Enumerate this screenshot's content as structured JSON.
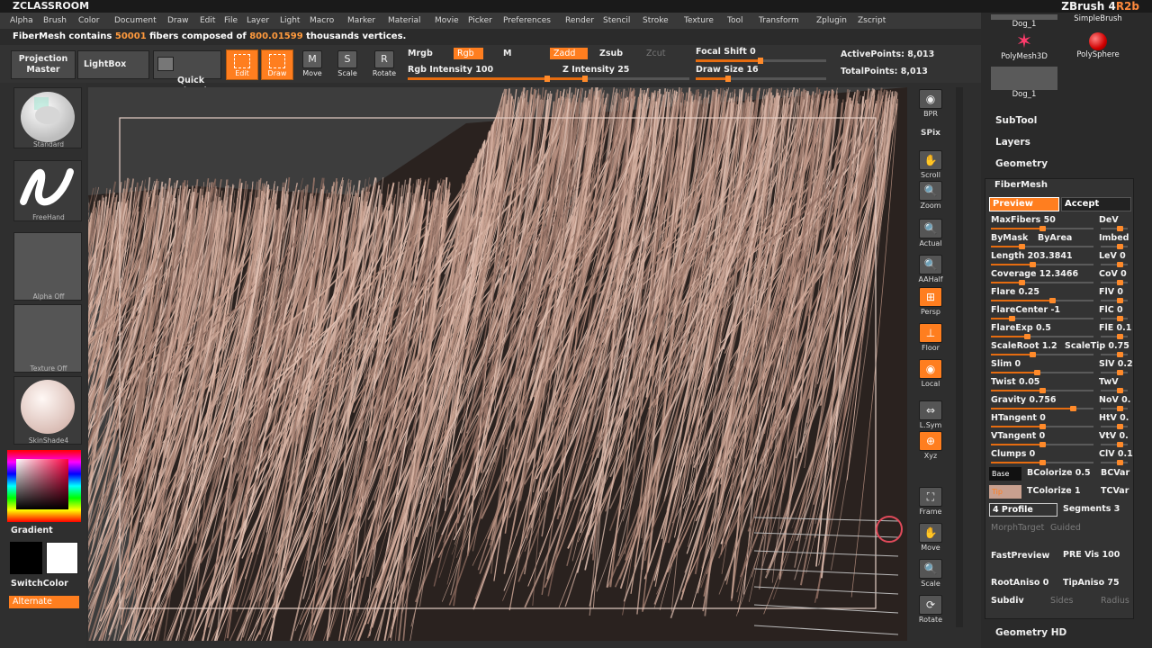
{
  "title_bar": {
    "brand": "ZCLASSROOM",
    "product": "ZBrush 4",
    "version": "R2b"
  },
  "menu": [
    "Alpha",
    "Brush",
    "Color",
    "Document",
    "Draw",
    "Edit",
    "File",
    "Layer",
    "Light",
    "Macro",
    "Marker",
    "Material",
    "Movie",
    "Picker",
    "Preferences",
    "Render",
    "Stencil",
    "Stroke",
    "Texture",
    "Tool",
    "Transform",
    "Zplugin",
    "Zscript"
  ],
  "notice": {
    "pre": "FiberMesh contains",
    "fibers": "50001",
    "mid": "fibers composed of",
    "verts": "800.01599",
    "post": "thousands vertices."
  },
  "toolbar": {
    "projection_master": "Projection\nMaster",
    "lightbox": "LightBox",
    "quick_sketch": "Quick\nSketch",
    "edit": "Edit",
    "draw": "Draw",
    "move": "Move",
    "scale": "Scale",
    "rotate": "Rotate",
    "mrgb": "Mrgb",
    "rgb": "Rgb",
    "m": "M",
    "zadd": "Zadd",
    "zsub": "Zsub",
    "zcut": "Zcut",
    "rgb_intensity": "Rgb  Intensity 100",
    "rgb_intensity_value": 100,
    "z_intensity": "Z  Intensity 25",
    "z_intensity_value": 25,
    "focal_shift": "Focal  Shift 0",
    "draw_size": "Draw  Size 16",
    "draw_size_value": 16,
    "active_points": "ActivePoints: 8,013",
    "total_points": "TotalPoints: 8,013"
  },
  "left_shelf": {
    "brush": "Standard",
    "stroke": "FreeHand",
    "alpha": "Alpha  Off",
    "texture": "Texture  Off",
    "material": "SkinShade4",
    "gradient": "Gradient",
    "switch_color": "SwitchColor",
    "alternate": "Alternate",
    "main_color": "#ffffff",
    "secondary_color": "#000000"
  },
  "right_shelf": [
    "BPR",
    "SPix",
    "Scroll",
    "Zoom",
    "Actual",
    "AAHalf",
    "Persp",
    "Floor",
    "Local",
    "L.Sym",
    "Xyz",
    "Frame",
    "Move",
    "Scale",
    "Rotate"
  ],
  "tool_tray": {
    "thumbs": [
      {
        "label": "Dog_1",
        "icon": "dog-mesh-icon"
      },
      {
        "label": "SimpleBrush",
        "icon": "simplebrush-icon"
      },
      {
        "label": "PolyMesh3D",
        "icon": "star-icon"
      },
      {
        "label": "PolySphere",
        "icon": "sphere-icon"
      },
      {
        "label": "Dog_1",
        "icon": "dog-mesh-icon"
      }
    ],
    "subtool": "SubTool",
    "layers": "Layers",
    "geometry": "Geometry",
    "geometry_hd": "Geometry HD"
  },
  "fibermesh": {
    "title": "FiberMesh",
    "preview": "Preview",
    "accept": "Accept",
    "rows": [
      {
        "left": "MaxFibers 50",
        "right": "DeV",
        "fill": 0.5
      },
      {
        "left": "ByMask",
        "mid": "ByArea",
        "right": "Imbed",
        "fill": 0.3
      },
      {
        "left": "Length 203.3841",
        "right": "LeV 0",
        "fill": 0.4
      },
      {
        "left": "Coverage 12.3466",
        "right": "CoV 0",
        "fill": 0.3
      },
      {
        "left": "Flare 0.25",
        "right": "FlV 0",
        "fill": 0.6
      },
      {
        "left": "FlareCenter -1",
        "right": "FlC 0",
        "fill": 0.2
      },
      {
        "left": "FlareExp 0.5",
        "right": "FlE 0.1",
        "fill": 0.35
      },
      {
        "left": "ScaleRoot 1.2",
        "right": "ScaleTip 0.75",
        "fill": 0.4
      },
      {
        "left": "Slim 0",
        "right": "SlV 0.2",
        "fill": 0.45
      },
      {
        "left": "Twist 0.05",
        "right": "TwV",
        "fill": 0.5
      },
      {
        "left": "Gravity 0.756",
        "right": "NoV 0.",
        "fill": 0.8
      },
      {
        "left": "HTangent 0",
        "right": "HtV 0.",
        "fill": 0.5
      },
      {
        "left": "VTangent 0",
        "right": "VtV 0.",
        "fill": 0.5
      },
      {
        "left": "Clumps 0",
        "right": "ClV 0.1",
        "fill": 0.5
      }
    ],
    "base": "Base",
    "tip": "Tip",
    "bcolorize": "BColorize 0.5",
    "bcvar": "BCVar",
    "tcolorize": "TColorize 1",
    "tcvar": "TCVar",
    "profile": "4 Profile",
    "segments": "Segments 3",
    "morph_target": "MorphTarget",
    "guided": "Guided",
    "fast_preview": "FastPreview",
    "pre_vis": "PRE  Vis 100",
    "root_aniso": "RootAniso 0",
    "tip_aniso": "TipAniso 75",
    "subdiv": "Subdiv",
    "sides": "Sides",
    "radius": "Radius"
  }
}
